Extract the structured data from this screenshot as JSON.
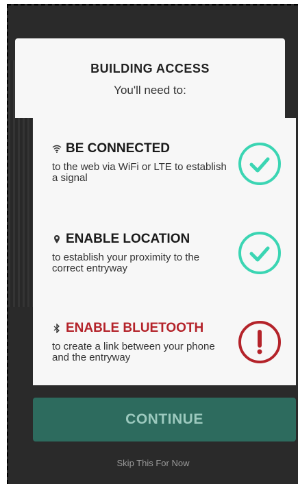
{
  "header": {
    "title": "BUILDING ACCESS",
    "subtitle": "You'll need to:"
  },
  "requirements": [
    {
      "icon": "wifi-icon",
      "title": "BE CONNECTED",
      "description": "to the web via WiFi or LTE to establish a signal",
      "status": "ok",
      "status_icon": "check-circle-icon",
      "color": "#1a1a1a"
    },
    {
      "icon": "location-pin-icon",
      "title": "ENABLE LOCATION",
      "description": "to establish your proximity to the correct entryway",
      "status": "ok",
      "status_icon": "check-circle-icon",
      "color": "#1a1a1a"
    },
    {
      "icon": "bluetooth-icon",
      "title": "ENABLE BLUETOOTH",
      "description": "to create a link between your phone and the entryway",
      "status": "error",
      "status_icon": "exclamation-circle-icon",
      "color": "#b4232a"
    }
  ],
  "continue_label": "CONTINUE",
  "skip_label": "Skip This For Now",
  "colors": {
    "accent_ok": "#3bd5b3",
    "accent_error": "#b4232a",
    "button_bg": "#2d6b5e",
    "button_text": "#9cc9be"
  }
}
